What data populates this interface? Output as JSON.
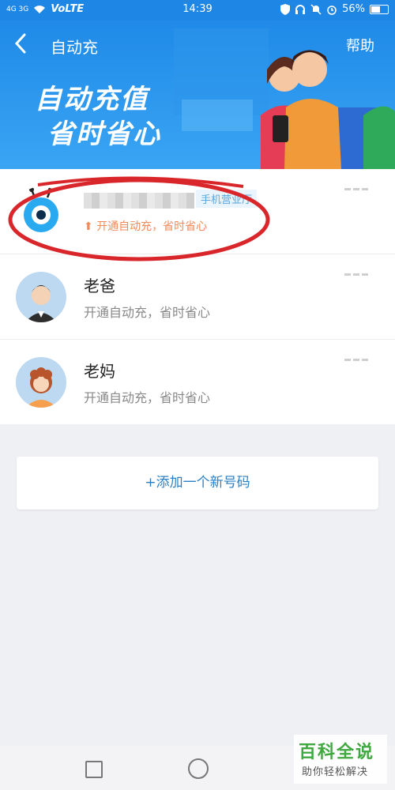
{
  "status_bar": {
    "network_left": "4G 3G",
    "volte": "VoLTE",
    "time": "14:39",
    "battery": "56%"
  },
  "header": {
    "back_icon": "chevron-left-icon",
    "title": "自动充",
    "help": "帮助",
    "slogan_line1": "自动充值",
    "slogan_line2": "省时省心"
  },
  "contacts": [
    {
      "name": "",
      "tag": "手机营业厅",
      "subtitle": "开通自动充，省时省心",
      "icon": "alien-mascot-icon"
    },
    {
      "name": "老爸",
      "subtitle": "开通自动充，省时省心",
      "icon": "man-avatar-icon"
    },
    {
      "name": "老妈",
      "subtitle": "开通自动充，省时省心",
      "icon": "woman-avatar-icon"
    }
  ],
  "add_button": "+添加一个新号码",
  "watermark": {
    "line1": "百科全说",
    "line2": "助你轻松解决"
  },
  "colors": {
    "header_blue": "#1f8ae8",
    "accent_link": "#2b7fc4",
    "annotation_red": "#d9262b",
    "promo_orange": "#f28a5a"
  }
}
